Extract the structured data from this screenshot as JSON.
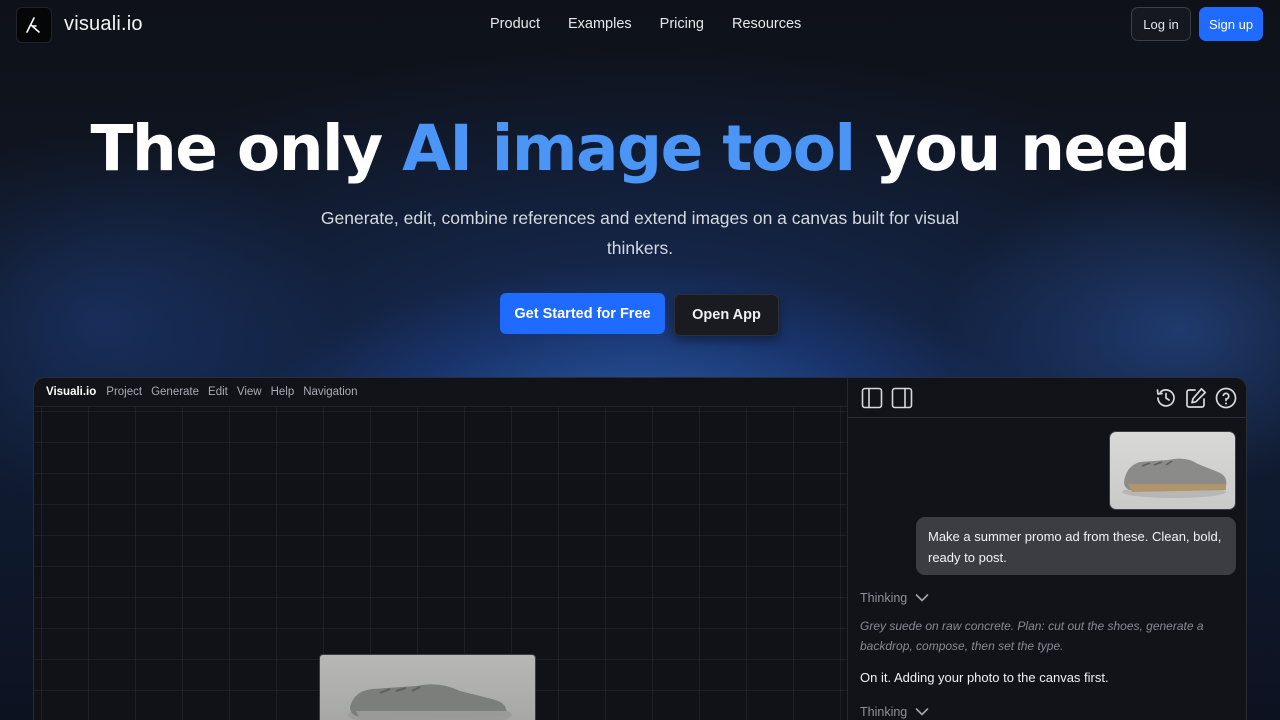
{
  "nav": {
    "brand": "visuali.io",
    "links": [
      "Product",
      "Examples",
      "Pricing",
      "Resources"
    ],
    "login": "Log in",
    "signup": "Sign up"
  },
  "hero": {
    "title_pre": "The only ",
    "title_highlight": "AI image tool",
    "title_post": " you need",
    "subtitle": "Generate, edit, combine references and extend images on a canvas built for visual thinkers.",
    "cta_primary": "Get Started for Free",
    "cta_secondary": "Open App"
  },
  "app": {
    "name": "Visuali.io",
    "menu": [
      "Project",
      "Generate",
      "Edit",
      "View",
      "Help",
      "Navigation"
    ],
    "panel": {
      "icons": [
        "sidebar-left-icon",
        "sidebar-right-icon",
        "history-icon",
        "edit-icon",
        "help-icon"
      ],
      "user_message": "Make a summer promo ad from these. Clean, bold, ready to post.",
      "thinking_label": "Thinking",
      "reasoning": "Grey suede on raw concrete. Plan: cut out the shoes, generate a backdrop, compose, then set the type.",
      "reply": "On it. Adding your photo to the canvas first.",
      "thinking_label_2": "Thinking"
    }
  },
  "colors": {
    "accent": "#1f6bff",
    "highlight": "#4a95f5",
    "background": "#0d1016"
  }
}
